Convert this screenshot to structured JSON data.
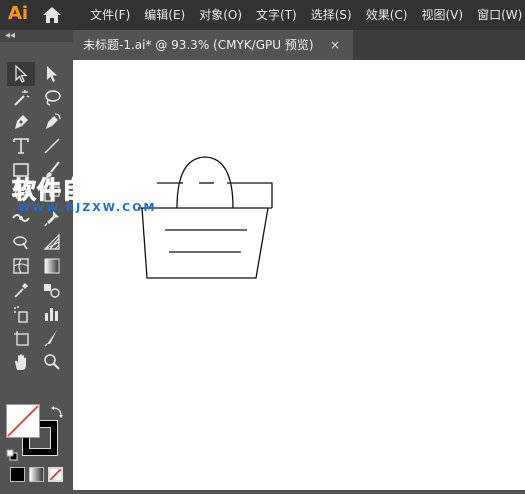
{
  "app": {
    "logo": "Ai"
  },
  "menus": [
    "文件(F)",
    "编辑(E)",
    "对象(O)",
    "文字(T)",
    "选择(S)",
    "效果(C)",
    "视图(V)",
    "窗口(W)"
  ],
  "document_tab": {
    "title": "未标题-1.ai* @ 93.3% (CMYK/GPU 预览)",
    "close": "×"
  },
  "toolbar": {
    "collapse": "◂◂"
  },
  "watermark": {
    "line1": "软件自学网",
    "line2": "WWW.RJZXW.COM"
  },
  "colors": {
    "accent": "#ff9a00",
    "watermark": "#1e6ec8"
  },
  "tools": [
    "selection-tool-icon",
    "direct-selection-tool-icon",
    "magic-wand-tool-icon",
    "lasso-tool-icon",
    "pen-tool-icon",
    "curvature-tool-icon",
    "type-tool-icon",
    "line-segment-tool-icon",
    "rectangle-tool-icon",
    "paintbrush-tool-icon",
    "rotate-tool-icon",
    "scale-tool-icon",
    "width-tool-icon",
    "puppet-warp-tool-icon",
    "shape-builder-tool-icon",
    "perspective-grid-tool-icon",
    "mesh-tool-icon",
    "gradient-tool-icon",
    "eyedropper-tool-icon",
    "blend-tool-icon",
    "symbol-sprayer-tool-icon",
    "column-graph-tool-icon",
    "artboard-tool-icon",
    "slice-tool-icon",
    "hand-tool-icon",
    "zoom-tool-icon"
  ]
}
